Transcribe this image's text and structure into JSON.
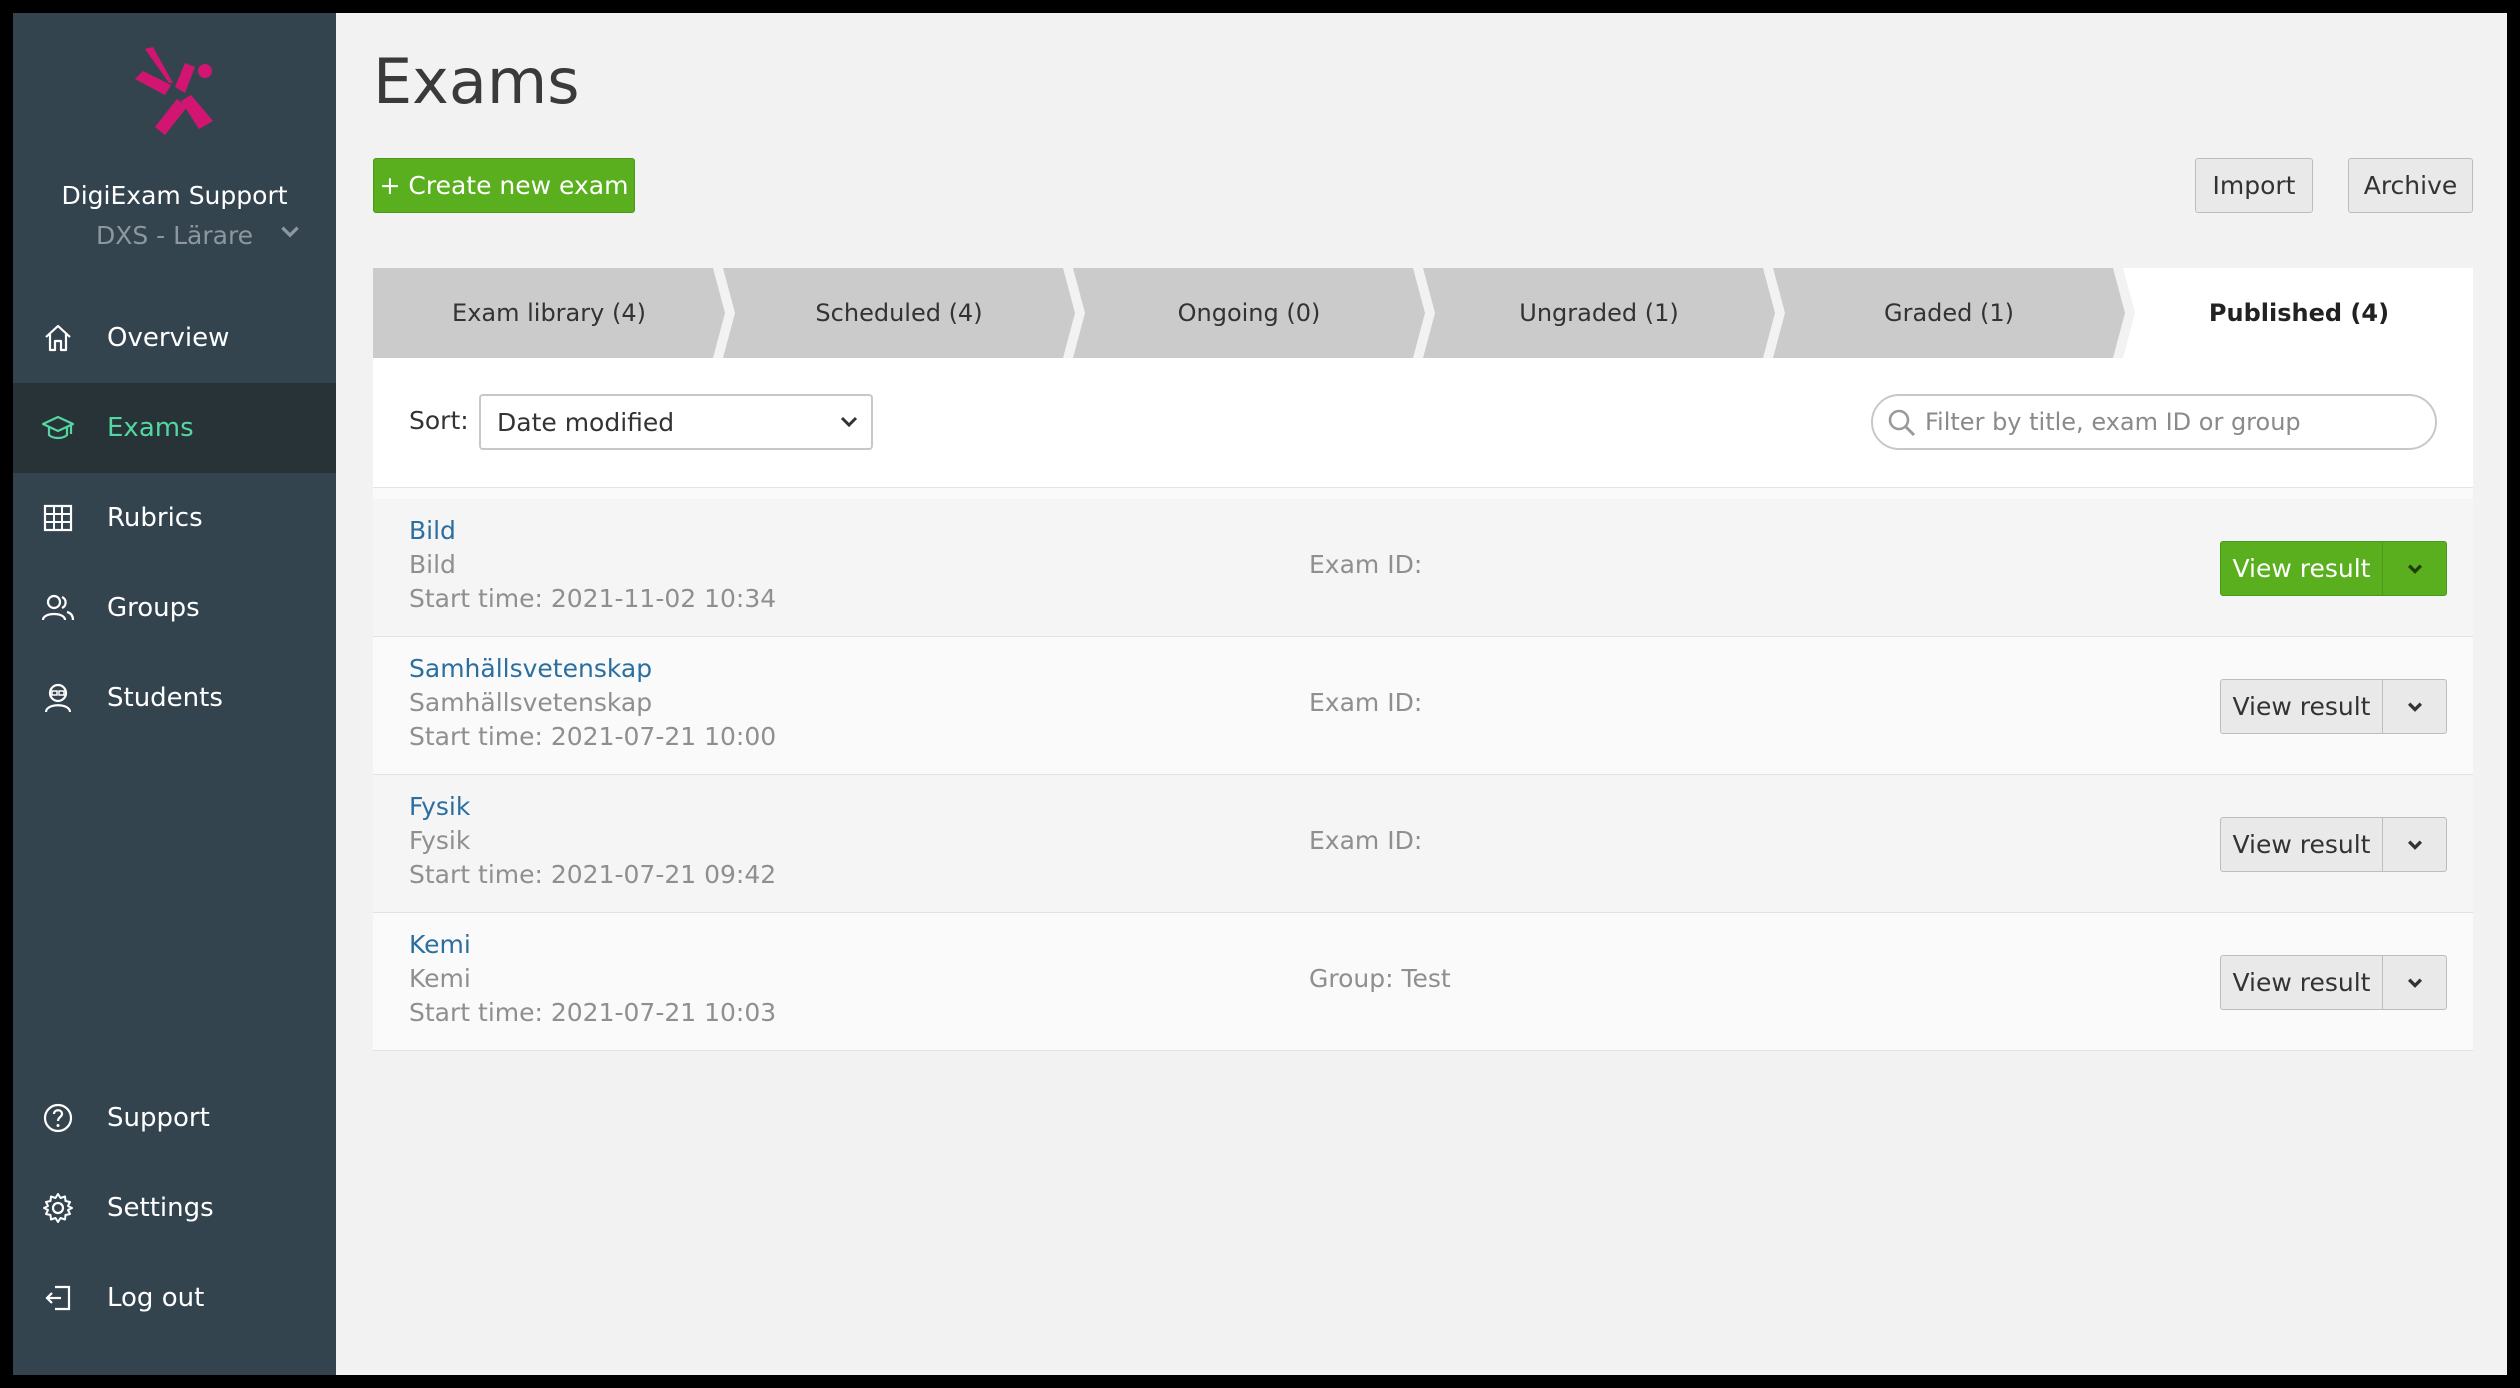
{
  "colors": {
    "sidebar_bg": "#34444f",
    "sidebar_active_bg": "#283338",
    "sidebar_active_text": "#54d6a0",
    "primary_green": "#5aaf1f",
    "logo_pink": "#d31572",
    "link_blue": "#2a6fa0"
  },
  "sidebar": {
    "org_name": "DigiExam Support",
    "org_sub": "DXS - Lärare",
    "items": [
      {
        "label": "Overview",
        "icon": "home-icon"
      },
      {
        "label": "Exams",
        "icon": "graduation-cap-icon",
        "active": true
      },
      {
        "label": "Rubrics",
        "icon": "table-icon"
      },
      {
        "label": "Groups",
        "icon": "users-icon"
      },
      {
        "label": "Students",
        "icon": "student-icon"
      }
    ],
    "bottom_items": [
      {
        "label": "Support",
        "icon": "question-icon"
      },
      {
        "label": "Settings",
        "icon": "gear-icon"
      },
      {
        "label": "Log out",
        "icon": "logout-icon"
      }
    ]
  },
  "header": {
    "title": "Exams",
    "create_label": "+ Create new exam",
    "import_label": "Import",
    "archive_label": "Archive"
  },
  "tabs": [
    {
      "label": "Exam library (4)"
    },
    {
      "label": "Scheduled (4)"
    },
    {
      "label": "Ongoing (0)"
    },
    {
      "label": "Ungraded (1)"
    },
    {
      "label": "Graded (1)"
    },
    {
      "label": "Published (4)",
      "active": true
    }
  ],
  "toolbar": {
    "sort_label": "Sort:",
    "sort_value": "Date modified",
    "filter_placeholder": "Filter by title, exam ID or group"
  },
  "exams": [
    {
      "title": "Bild",
      "subject": "Bild",
      "start": "Start time: 2021-11-02 10:34",
      "meta": "Exam ID: ",
      "button": "View result",
      "primary": true
    },
    {
      "title": "Samhällsvetenskap",
      "subject": "Samhällsvetenskap",
      "start": "Start time: 2021-07-21 10:00",
      "meta": "Exam ID: ",
      "button": "View result",
      "primary": false
    },
    {
      "title": "Fysik",
      "subject": "Fysik",
      "start": "Start time: 2021-07-21 09:42",
      "meta": "Exam ID: ",
      "button": "View result",
      "primary": false
    },
    {
      "title": "Kemi",
      "subject": "Kemi",
      "start": "Start time: 2021-07-21 10:03",
      "meta": "Group: Test",
      "button": "View result",
      "primary": false
    }
  ]
}
